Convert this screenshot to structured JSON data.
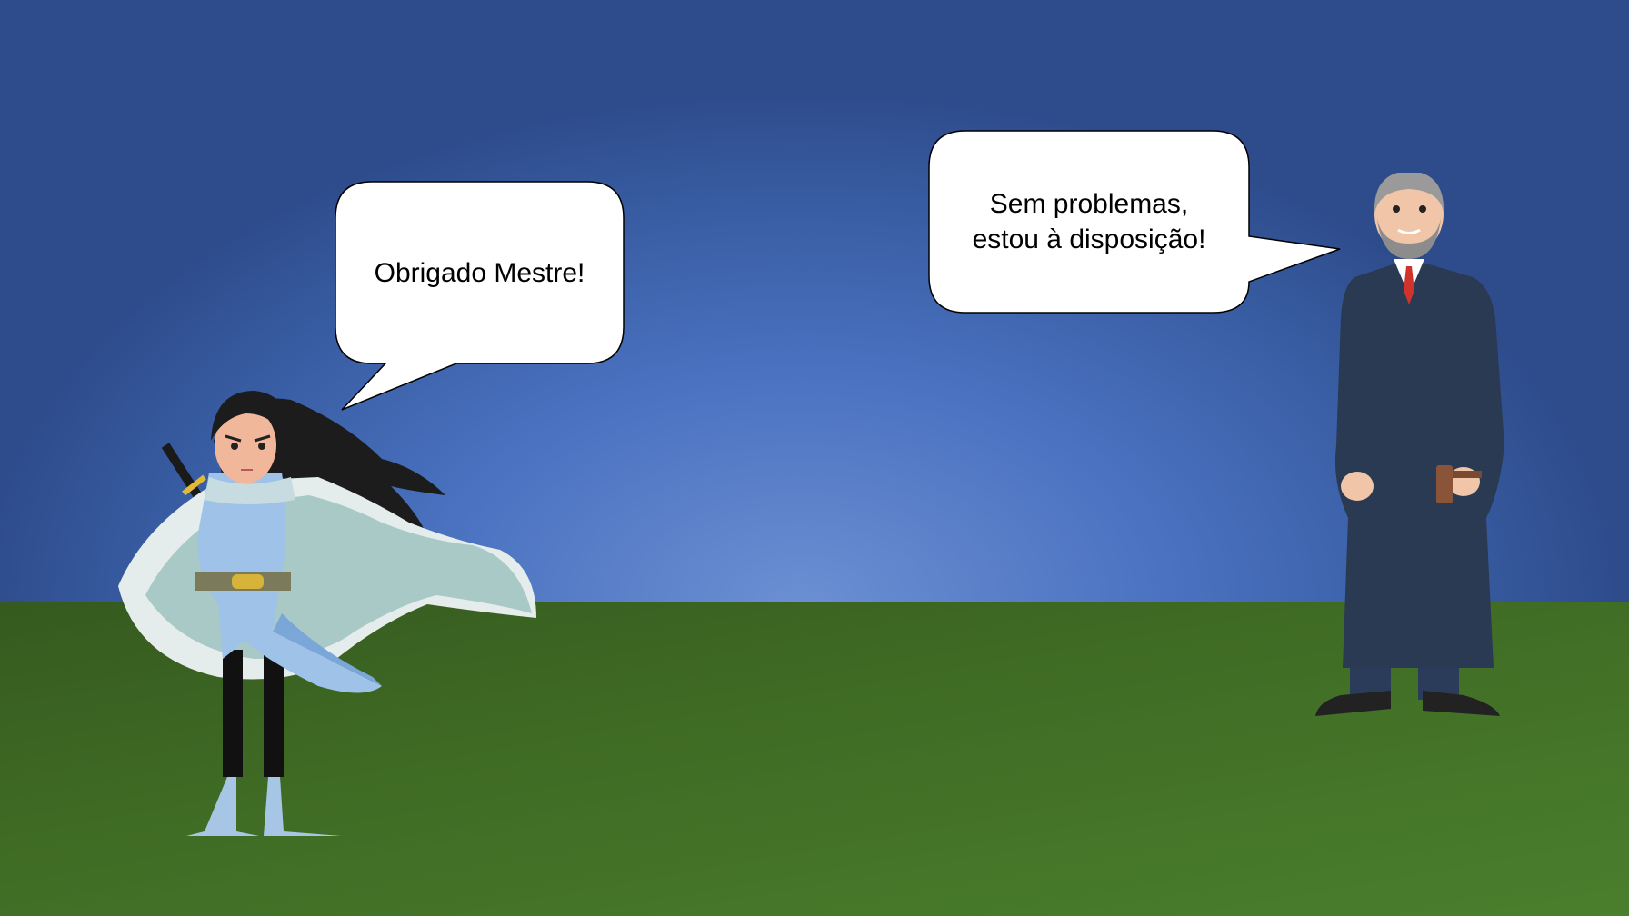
{
  "scene": {
    "bubble_left": {
      "speaker": "warrior",
      "text": "Obrigado Mestre!"
    },
    "bubble_right": {
      "speaker": "judge",
      "lines": [
        "Sem problemas,",
        "estou à disposição!"
      ]
    }
  },
  "colors": {
    "sky_center": "#6c8fd3",
    "sky_edge": "#2e4c8c",
    "ground": "#3f6b24",
    "robe": "#2a3a52",
    "tie": "#d0322c"
  }
}
